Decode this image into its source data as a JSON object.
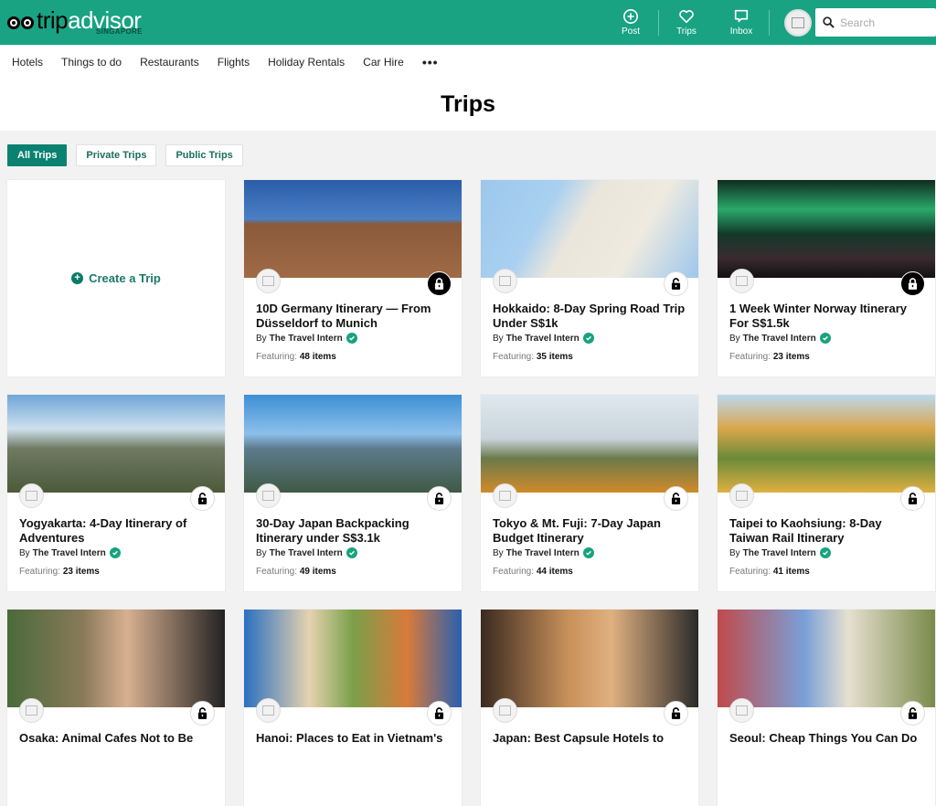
{
  "brand": {
    "name_dark": "trip",
    "name_light": "advisor",
    "region": "SINGAPORE"
  },
  "header_actions": [
    {
      "label": "Post",
      "icon": "plus-circle-icon"
    },
    {
      "label": "Trips",
      "icon": "heart-icon"
    },
    {
      "label": "Inbox",
      "icon": "message-icon"
    }
  ],
  "search": {
    "placeholder": "Search",
    "value": ""
  },
  "nav": [
    "Hotels",
    "Things to do",
    "Restaurants",
    "Flights",
    "Holiday Rentals",
    "Car Hire"
  ],
  "nav_more": "•••",
  "page_title": "Trips",
  "filters": [
    {
      "label": "All Trips",
      "active": true
    },
    {
      "label": "Private Trips",
      "active": false
    },
    {
      "label": "Public Trips",
      "active": false
    }
  ],
  "create_trip_label": "Create a Trip",
  "by_prefix": "By",
  "featuring_prefix": "Featuring:",
  "trips": [
    {
      "title": "10D Germany Itinerary — From Düsseldorf to Munich",
      "author": "The Travel Intern",
      "items": "48 items",
      "locked": true,
      "image": "gothic-church-blue-sky"
    },
    {
      "title": "Hokkaido: 8-Day Spring Road Trip Under S$1k",
      "author": "The Travel Intern",
      "items": "35 items",
      "locked": false,
      "image": "hokkaido-route-map"
    },
    {
      "title": "1 Week Winter Norway Itinerary For S$1.5k",
      "author": "The Travel Intern",
      "items": "23 items",
      "locked": true,
      "image": "northern-lights"
    },
    {
      "title": "Yogyakarta: 4-Day Itinerary of Adventures",
      "author": "The Travel Intern",
      "items": "23 items",
      "locked": false,
      "image": "volcano-jeep"
    },
    {
      "title": "30-Day Japan Backpacking Itinerary under S$3.1k",
      "author": "The Travel Intern",
      "items": "49 items",
      "locked": false,
      "image": "mt-fuji-city"
    },
    {
      "title": "Tokyo & Mt. Fuji: 7-Day Japan Budget Itinerary",
      "author": "The Travel Intern",
      "items": "44 items",
      "locked": false,
      "image": "fuji-flower-field"
    },
    {
      "title": "Taipei to Kaohsiung: 8-Day Taiwan Rail Itinerary",
      "author": "The Travel Intern",
      "items": "41 items",
      "locked": false,
      "image": "pagodas-dragon-tiger"
    },
    {
      "title": "Osaka: Animal Cafes Not to Be",
      "author": "",
      "items": "",
      "locked": false,
      "image": "chameleon-cafe"
    },
    {
      "title": "Hanoi: Places to Eat in Vietnam's",
      "author": "",
      "items": "",
      "locked": false,
      "image": "vietnamese-food"
    },
    {
      "title": "Japan: Best Capsule Hotels to",
      "author": "",
      "items": "",
      "locked": false,
      "image": "bookshelf-hotel"
    },
    {
      "title": "Seoul: Cheap Things You Can Do",
      "author": "",
      "items": "",
      "locked": false,
      "image": "colorful-village"
    }
  ]
}
